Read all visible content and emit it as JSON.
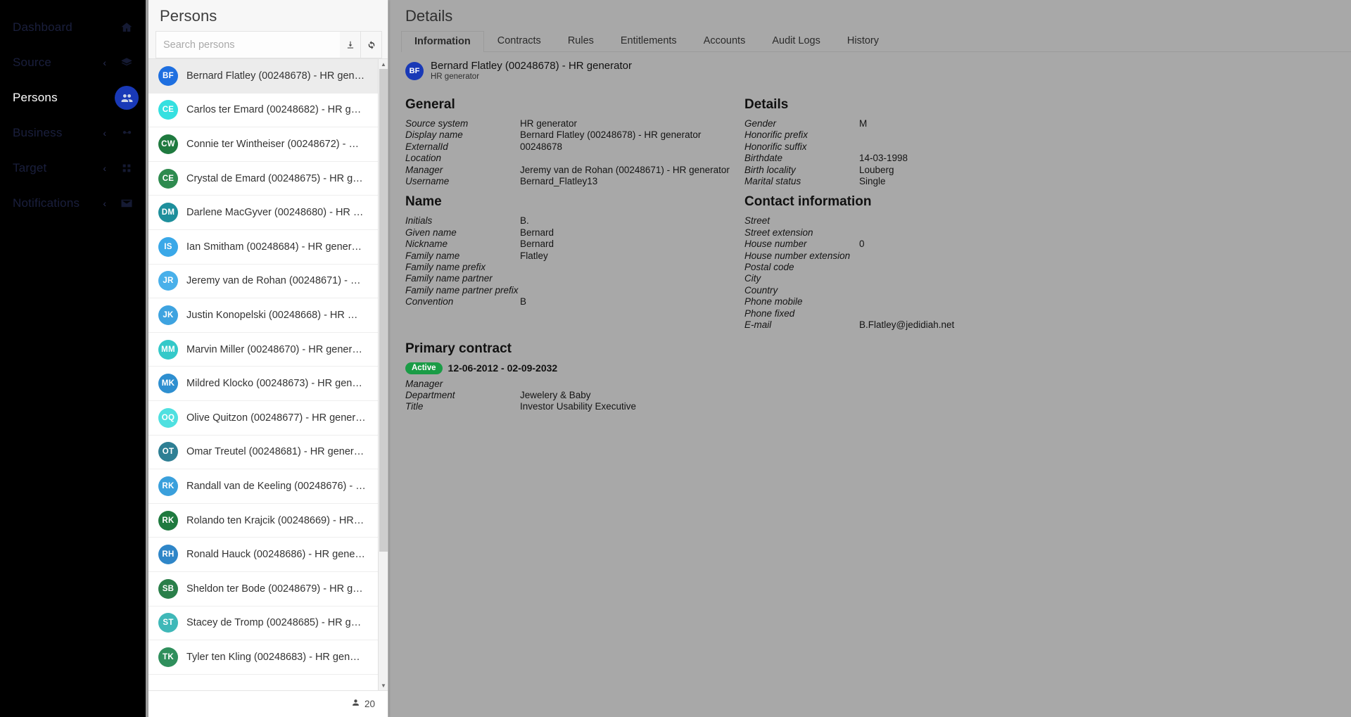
{
  "sidebar": {
    "items": [
      {
        "label": "Dashboard",
        "icon": "home-icon",
        "chevron": "",
        "active": false
      },
      {
        "label": "Source",
        "icon": "layers-icon",
        "chevron": "‹",
        "active": false
      },
      {
        "label": "Persons",
        "icon": "people-icon",
        "chevron": "",
        "active": true
      },
      {
        "label": "Business",
        "icon": "business-icon",
        "chevron": "‹",
        "active": false
      },
      {
        "label": "Target",
        "icon": "grid-icon",
        "chevron": "‹",
        "active": false
      },
      {
        "label": "Notifications",
        "icon": "envelope-icon",
        "chevron": "‹",
        "active": false
      }
    ],
    "active_color": "#1939b7"
  },
  "persons_panel": {
    "title": "Persons",
    "search": {
      "placeholder": "Search persons",
      "value": ""
    },
    "download_button_title": "Download",
    "refresh_button_title": "Refresh",
    "footer_count": "20",
    "list": [
      {
        "initials": "BF",
        "color": "#1e6fe0",
        "name": "Bernard Flatley (00248678) - HR gen…",
        "selected": true
      },
      {
        "initials": "CE",
        "color": "#35e0e0",
        "name": "Carlos ter Emard (00248682) - HR g…",
        "selected": false
      },
      {
        "initials": "CW",
        "color": "#1f7a3f",
        "name": "Connie ter Wintheiser (00248672) - …",
        "selected": false
      },
      {
        "initials": "CE",
        "color": "#2e8b4f",
        "name": "Crystal de Emard (00248675) - HR g…",
        "selected": false
      },
      {
        "initials": "DM",
        "color": "#1e8f9c",
        "name": "Darlene MacGyver (00248680) - HR …",
        "selected": false
      },
      {
        "initials": "IS",
        "color": "#3aa8e8",
        "name": "Ian Smitham (00248684) - HR gener…",
        "selected": false
      },
      {
        "initials": "JR",
        "color": "#49b0ea",
        "name": "Jeremy van de Rohan (00248671) - …",
        "selected": false
      },
      {
        "initials": "JK",
        "color": "#3ea3e0",
        "name": "Justin Konopelski (00248668) - HR …",
        "selected": false
      },
      {
        "initials": "MM",
        "color": "#34c9c9",
        "name": "Marvin Miller (00248670) - HR gener…",
        "selected": false
      },
      {
        "initials": "MK",
        "color": "#2e8fd0",
        "name": "Mildred Klocko (00248673) - HR gen…",
        "selected": false
      },
      {
        "initials": "OQ",
        "color": "#4fe0e0",
        "name": "Olive Quitzon (00248677) - HR gener…",
        "selected": false
      },
      {
        "initials": "OT",
        "color": "#2e7f94",
        "name": "Omar Treutel (00248681) - HR gener…",
        "selected": false
      },
      {
        "initials": "RK",
        "color": "#3aa0dc",
        "name": "Randall van de Keeling (00248676) - …",
        "selected": false
      },
      {
        "initials": "RK",
        "color": "#1f7a3f",
        "name": "Rolando ten Krajcik (00248669) - HR…",
        "selected": false
      },
      {
        "initials": "RH",
        "color": "#2f86c8",
        "name": "Ronald Hauck (00248686) - HR gene…",
        "selected": false
      },
      {
        "initials": "SB",
        "color": "#2a7f4a",
        "name": "Sheldon ter Bode (00248679) - HR g…",
        "selected": false
      },
      {
        "initials": "ST",
        "color": "#3fb8b8",
        "name": "Stacey de Tromp (00248685) - HR g…",
        "selected": false
      },
      {
        "initials": "TK",
        "color": "#2f8f5c",
        "name": "Tyler ten Kling (00248683) - HR gen…",
        "selected": false
      }
    ]
  },
  "details": {
    "title": "Details",
    "tabs": [
      {
        "label": "Information",
        "active": true
      },
      {
        "label": "Contracts",
        "active": false
      },
      {
        "label": "Rules",
        "active": false
      },
      {
        "label": "Entitlements",
        "active": false
      },
      {
        "label": "Accounts",
        "active": false
      },
      {
        "label": "Audit Logs",
        "active": false
      },
      {
        "label": "History",
        "active": false
      }
    ],
    "entity": {
      "initials": "BF",
      "name": "Bernard Flatley (00248678) - HR generator",
      "subtitle": "HR generator"
    },
    "sections": {
      "general": {
        "title": "General",
        "rows": [
          {
            "key": "Source system",
            "value": "HR generator"
          },
          {
            "key": "Display name",
            "value": "Bernard Flatley (00248678) - HR generator"
          },
          {
            "key": "ExternalId",
            "value": "00248678"
          },
          {
            "key": "Location",
            "value": ""
          },
          {
            "key": "Manager",
            "value": "Jeremy van de Rohan (00248671) - HR generator"
          },
          {
            "key": "Username",
            "value": "Bernard_Flatley13"
          }
        ]
      },
      "name": {
        "title": "Name",
        "rows": [
          {
            "key": "Initials",
            "value": "B."
          },
          {
            "key": "Given name",
            "value": "Bernard"
          },
          {
            "key": "Nickname",
            "value": "Bernard"
          },
          {
            "key": "Family name",
            "value": "Flatley"
          },
          {
            "key": "Family name prefix",
            "value": ""
          },
          {
            "key": "Family name partner",
            "value": ""
          },
          {
            "key": "Family name partner prefix",
            "value": ""
          },
          {
            "key": "Convention",
            "value": "B"
          }
        ]
      },
      "details": {
        "title": "Details",
        "rows": [
          {
            "key": "Gender",
            "value": "M"
          },
          {
            "key": "Honorific prefix",
            "value": ""
          },
          {
            "key": "Honorific suffix",
            "value": ""
          },
          {
            "key": "Birthdate",
            "value": "14-03-1998"
          },
          {
            "key": "Birth locality",
            "value": "Louberg"
          },
          {
            "key": "Marital status",
            "value": "Single"
          }
        ]
      },
      "contact": {
        "title": "Contact information",
        "rows": [
          {
            "key": "Street",
            "value": ""
          },
          {
            "key": "Street extension",
            "value": ""
          },
          {
            "key": "House number",
            "value": "0"
          },
          {
            "key": "House number extension",
            "value": ""
          },
          {
            "key": "Postal code",
            "value": ""
          },
          {
            "key": "City",
            "value": ""
          },
          {
            "key": "Country",
            "value": ""
          },
          {
            "key": "Phone mobile",
            "value": ""
          },
          {
            "key": "Phone fixed",
            "value": ""
          },
          {
            "key": "E-mail",
            "value": "B.Flatley@jedidiah.net"
          }
        ]
      },
      "primary_contract": {
        "title": "Primary contract",
        "status_badge": "Active",
        "status_color": "#1a9c46",
        "dates": "12-06-2012 - 02-09-2032",
        "rows": [
          {
            "key": "Manager",
            "value": ""
          },
          {
            "key": "Department",
            "value": "Jewelery & Baby"
          },
          {
            "key": "Title",
            "value": "Investor Usability Executive"
          }
        ]
      }
    }
  }
}
